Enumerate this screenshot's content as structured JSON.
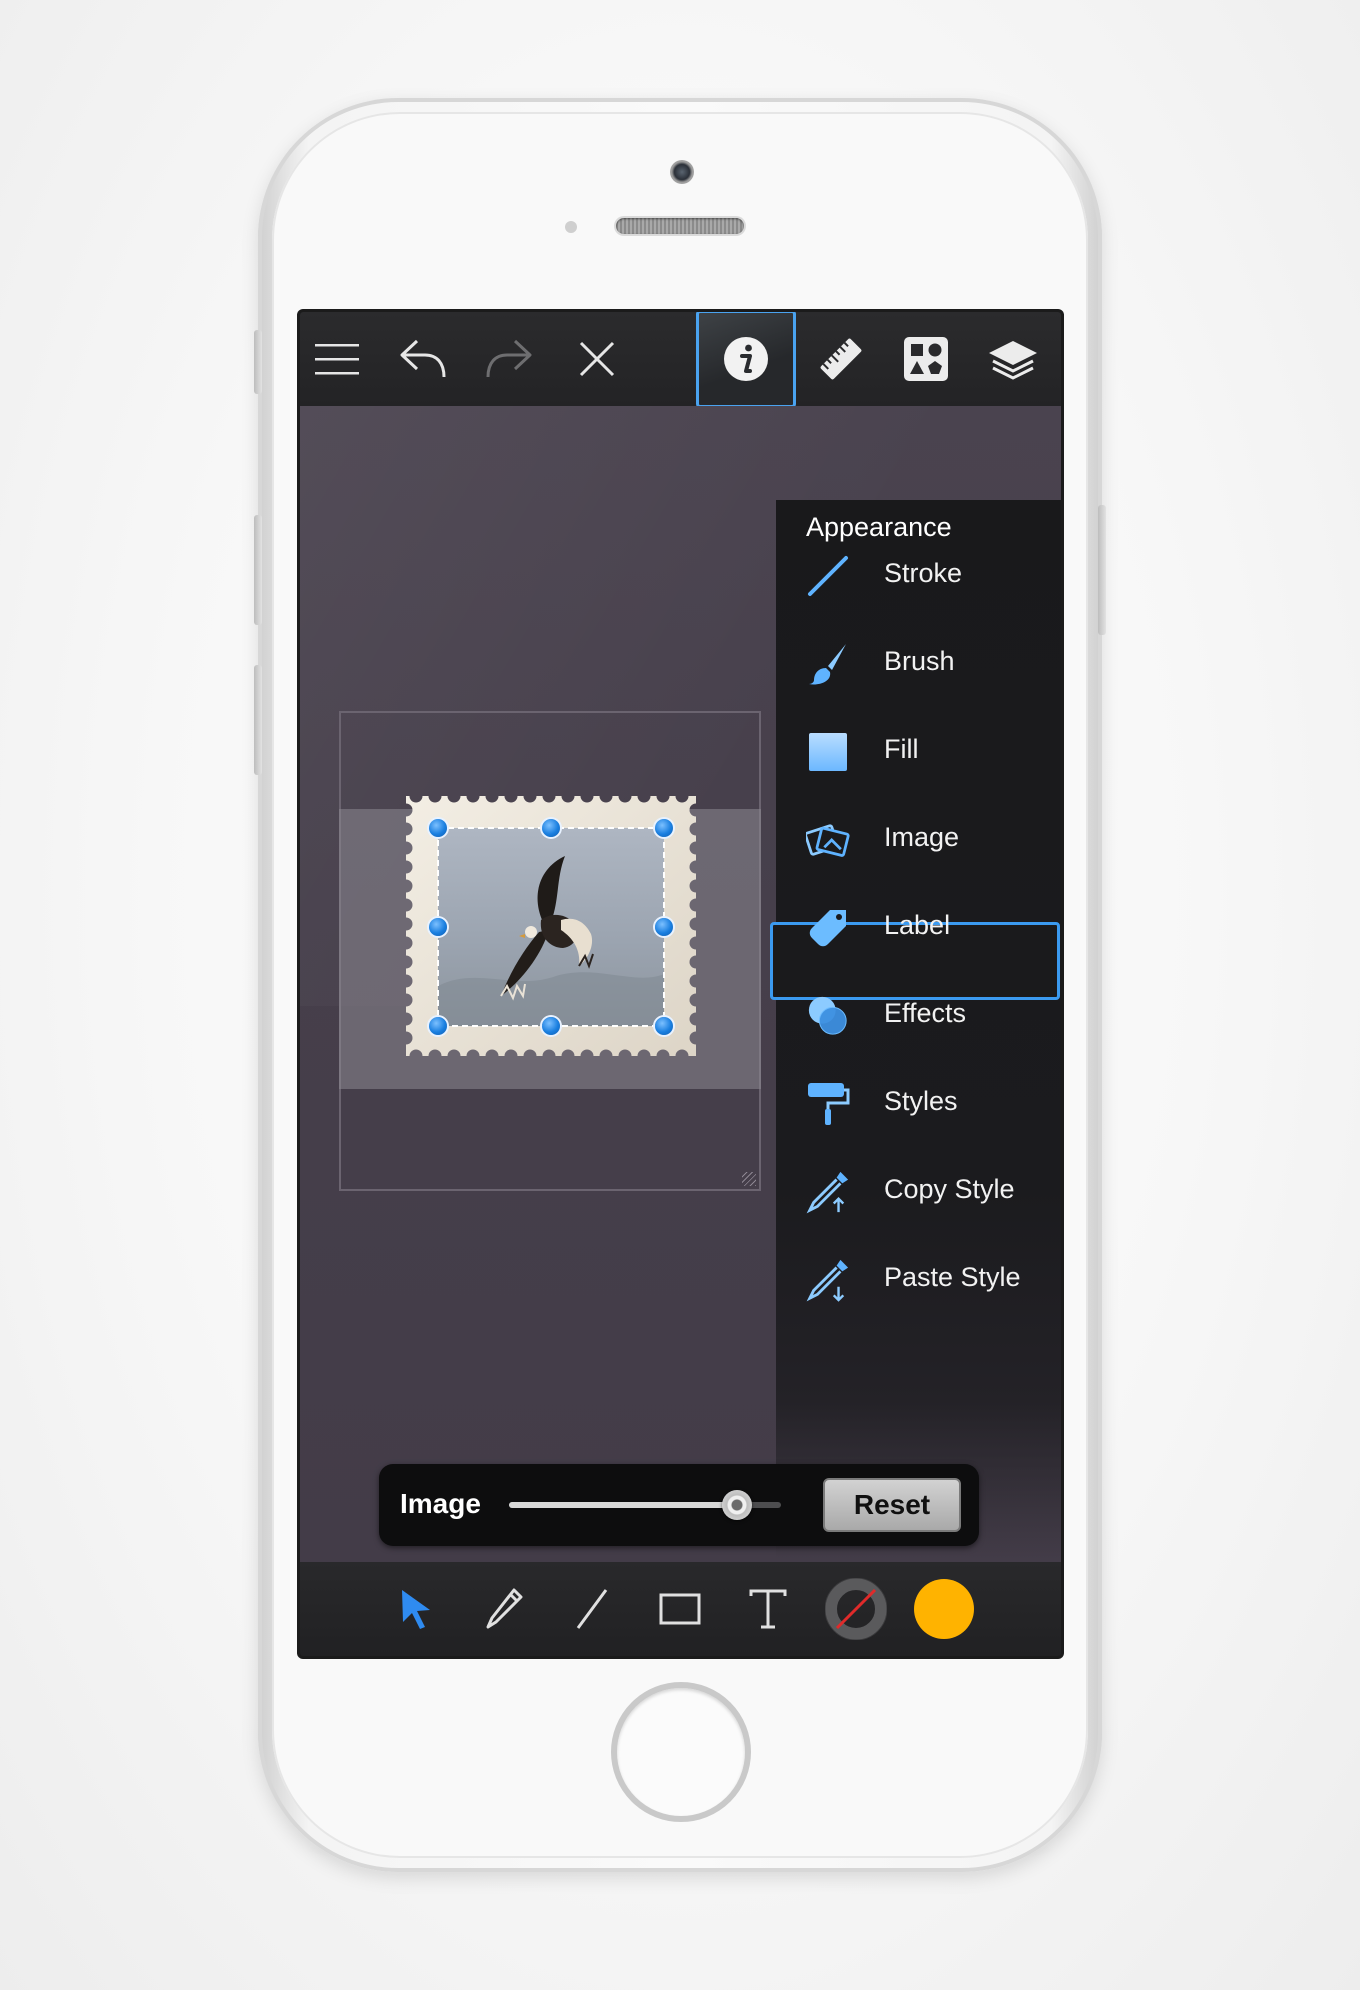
{
  "colors": {
    "accent_blue": "#4aa3f0",
    "fill_color": "#ffb300",
    "panel_bg": "#19191b",
    "canvas_bg": "#463f4b"
  },
  "toolbar": {
    "buttons": [
      {
        "name": "menu",
        "icon": "hamburger-icon"
      },
      {
        "name": "undo",
        "icon": "undo-icon"
      },
      {
        "name": "redo",
        "icon": "redo-icon",
        "disabled": true
      },
      {
        "name": "delete",
        "icon": "close-icon"
      },
      {
        "name": "inspector",
        "icon": "info-icon",
        "active": true
      },
      {
        "name": "measure",
        "icon": "ruler-icon"
      },
      {
        "name": "library",
        "icon": "shapes-library-icon"
      },
      {
        "name": "layers",
        "icon": "layers-icon"
      }
    ]
  },
  "panel": {
    "title": "Appearance",
    "items": [
      {
        "label": "Stroke",
        "icon": "stroke-icon"
      },
      {
        "label": "Brush",
        "icon": "brush-icon"
      },
      {
        "label": "Fill",
        "icon": "fill-icon"
      },
      {
        "label": "Image",
        "icon": "image-icon",
        "selected": true
      },
      {
        "label": "Label",
        "icon": "label-tag-icon"
      },
      {
        "label": "Effects",
        "icon": "effects-icon"
      },
      {
        "label": "Styles",
        "icon": "paint-roller-icon"
      },
      {
        "label": "Copy Style",
        "icon": "eyedropper-copy-icon"
      },
      {
        "label": "Paste Style",
        "icon": "eyedropper-paste-icon"
      }
    ]
  },
  "slider": {
    "label": "Image",
    "value_fraction": 0.84,
    "reset_label": "Reset"
  },
  "tools": [
    {
      "name": "select",
      "icon": "arrow-pointer-icon",
      "active": true
    },
    {
      "name": "pencil",
      "icon": "pencil-icon"
    },
    {
      "name": "line",
      "icon": "line-icon"
    },
    {
      "name": "rectangle",
      "icon": "rectangle-icon"
    },
    {
      "name": "text",
      "icon": "text-icon"
    },
    {
      "name": "stroke-color",
      "icon": "stroke-color-swatch-icon"
    },
    {
      "name": "fill-color",
      "icon": "fill-color-swatch-icon"
    }
  ],
  "canvas": {
    "selected_object": "stamp-image"
  }
}
